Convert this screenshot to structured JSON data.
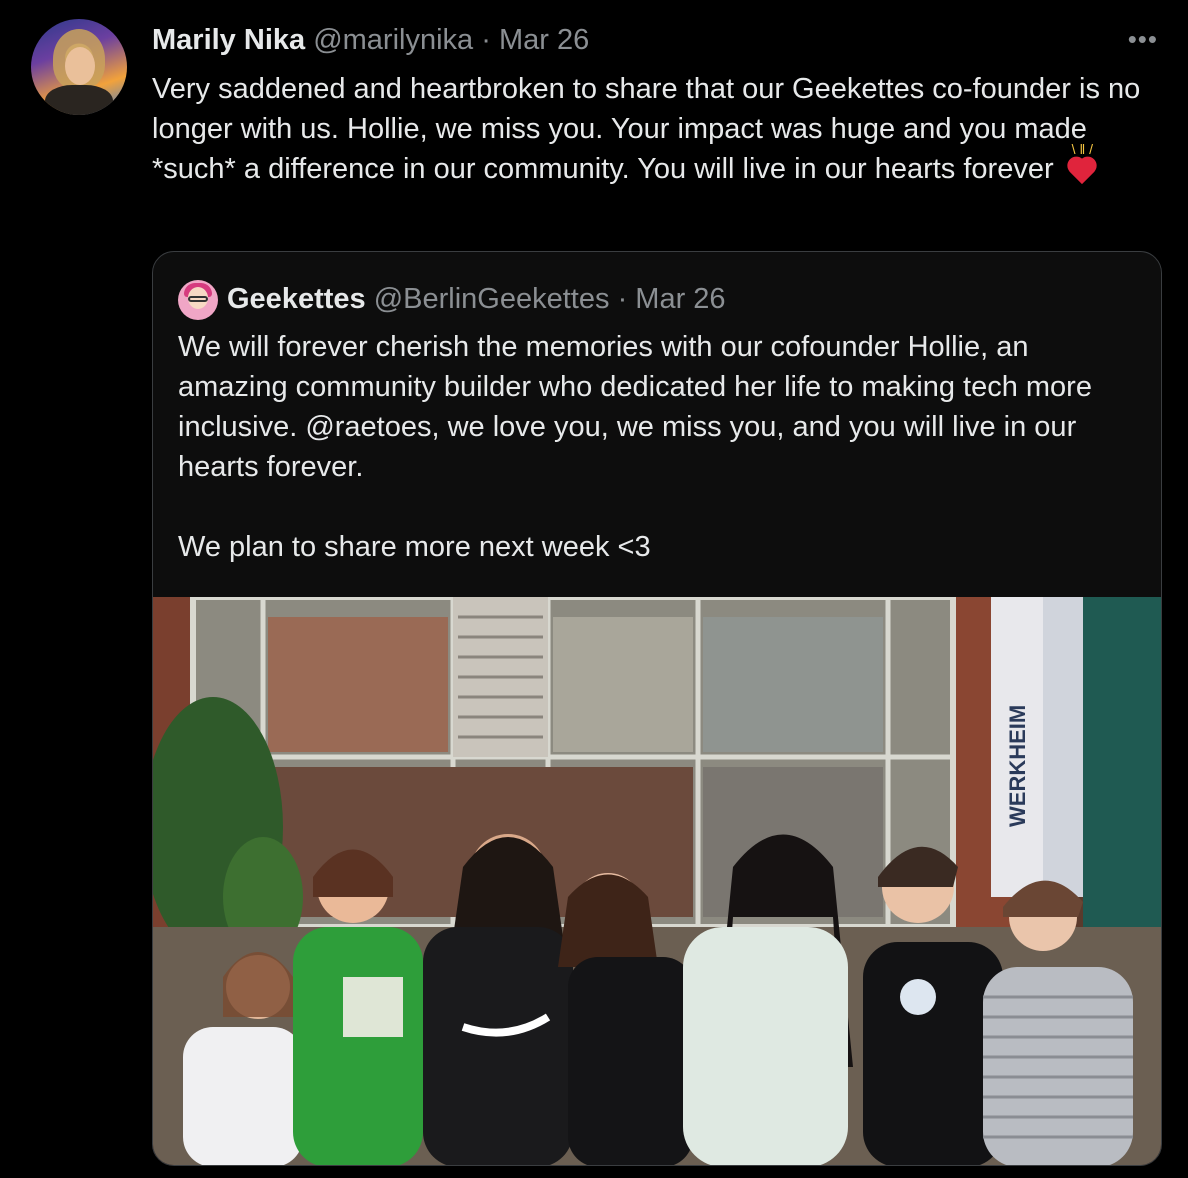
{
  "tweet": {
    "name": "Marily Nika",
    "handle": "@marilynika",
    "separator": "·",
    "date": "Mar 26",
    "more": "•••",
    "text": "Very saddened and heartbroken to share that our Geekettes co-founder is no longer with us. Hollie, we miss you. Your impact was huge and you made *such* a difference in our community. You will live in our hearts forever"
  },
  "quoted": {
    "name": "Geekettes",
    "handle": "@BerlinGeekettes",
    "separator": "·",
    "date": "Mar 26",
    "paragraph1": "We will forever cherish the memories with our cofounder Hollie, an amazing community builder who dedicated her life to making tech more inclusive. @raetoes, we love you, we miss you, and you will live in our hearts forever.",
    "paragraph2": "We plan to share more next week <3",
    "photo_sign": "WERKHEIM"
  },
  "colors": {
    "background": "#000000",
    "text": "#e7e9ea",
    "muted": "#8b8f93",
    "border": "#3a3d40",
    "heart": "#e0243c"
  }
}
